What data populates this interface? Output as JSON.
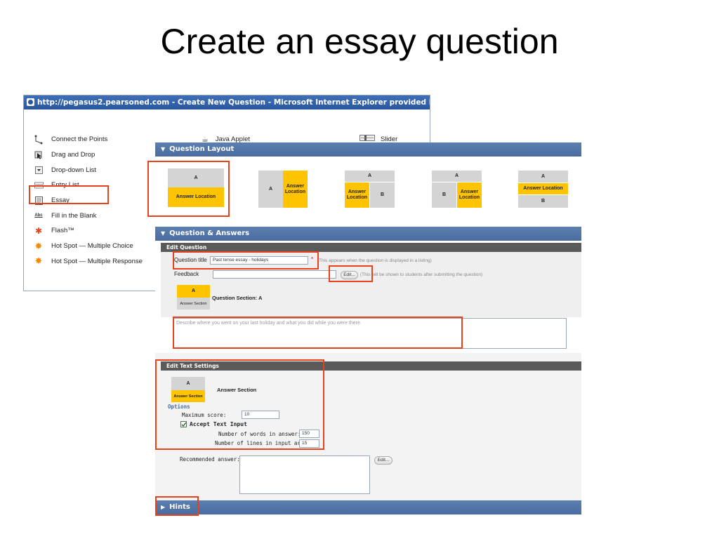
{
  "slide_title": "Create an essay question",
  "window_title": "http://pegasus2.pearsoned.com - Create New Question - Microsoft Internet Explorer provided by Pearson Technology",
  "question_types": [
    {
      "label": "Connect the Points",
      "icon": "connect-points-icon"
    },
    {
      "label": "Drag and Drop",
      "icon": "drag-drop-icon"
    },
    {
      "label": "Drop-down List",
      "icon": "dropdown-list-icon"
    },
    {
      "label": "Entry List",
      "icon": "entry-list-icon"
    },
    {
      "label": "Essay",
      "icon": "essay-icon"
    },
    {
      "label": "Fill in the Blank",
      "icon": "fill-blank-icon"
    },
    {
      "label": "Flash™",
      "icon": "flash-icon"
    },
    {
      "label": "Hot Spot — Multiple Choice",
      "icon": "hotspot-icon"
    },
    {
      "label": "Hot Spot — Multiple Response",
      "icon": "hotspot-icon"
    }
  ],
  "extra_types": {
    "java_applet": "Java Applet",
    "slider": "Slider",
    "abc_glyph": "Abc"
  },
  "layout_section": {
    "title": "Question Layout",
    "a": "A",
    "b": "B",
    "answer_location": "Answer Location",
    "answer_location_2line": "Answer\nLocation"
  },
  "qa_section": {
    "title": "Question & Answers",
    "edit_question": "Edit Question",
    "question_title_label": "Question title",
    "question_title_value": "Past tense essay - holidays",
    "required_mark": "*",
    "question_title_hint": "This appears when the question is displayed in a listing)",
    "feedback_label": "Feedback",
    "edit_button": "Edit...",
    "feedback_hint": "(This will be shown to students after submitting the question)",
    "section_a": "A",
    "answer_section": "Answer Section",
    "question_section_label": "Question Section: A",
    "prompt_text": "Describe where you went on your last holiday and what you did while you were there."
  },
  "text_settings": {
    "title": "Edit Text Settings",
    "a": "A",
    "answer_section_small": "Answer Section",
    "answer_section_label": "Answer Section",
    "options": "Options",
    "max_score_label": "Maximum score:",
    "max_score_value": "10",
    "accept_text_input": "Accept Text Input",
    "num_words_label": "Number of words in answer:",
    "num_words_value": "150",
    "num_lines_label": "Number of lines in input area:",
    "num_lines_value": "15",
    "recommended_label": "Recommended answer:",
    "edit_button": "Edit..."
  },
  "hints_section": {
    "title": "Hints"
  },
  "colors": {
    "section_bar": "#4a6ca0",
    "highlight": "#e8421c",
    "answer_yellow": "#ffc400",
    "layout_gray": "#d4d4d4"
  }
}
